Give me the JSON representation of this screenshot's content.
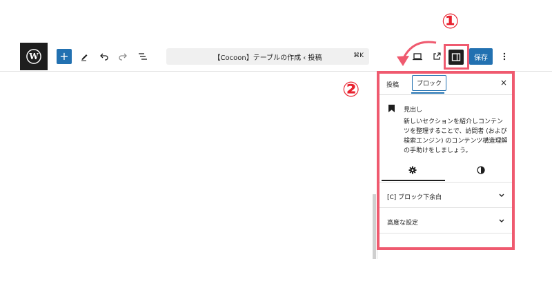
{
  "toolbar": {
    "add_label": "+",
    "document_title": "【Cocoon】テーブルの作成 ‹ 投稿",
    "shortcut": "⌘K",
    "save_label": "保存",
    "icons": [
      "wordpress-logo",
      "add-block",
      "pencil-tool",
      "undo",
      "redo",
      "document-overview",
      "preview",
      "view-post",
      "settings-sidebar",
      "more-options"
    ]
  },
  "annotations": {
    "marker_1": "①",
    "marker_2": "②",
    "highlight_color": "#ef5a6f",
    "marker_color": "#e8222f"
  },
  "sidebar": {
    "tabs": {
      "post": "投稿",
      "block": "ブロック"
    },
    "close": "×",
    "block": {
      "name": "見出し",
      "description": "新しいセクションを紹介しコンテンツを整理することで、訪問者 (および検索エンジン) のコンテンツ構造理解の手助けをしましょう。"
    },
    "settings_tabs": [
      "gear-icon",
      "contrast-icon"
    ],
    "panels": [
      {
        "label": "[C] ブロック下余白"
      },
      {
        "label": "高度な設定"
      }
    ]
  },
  "colors": {
    "accent": "#2271b1",
    "dark": "#1e1e1e"
  }
}
